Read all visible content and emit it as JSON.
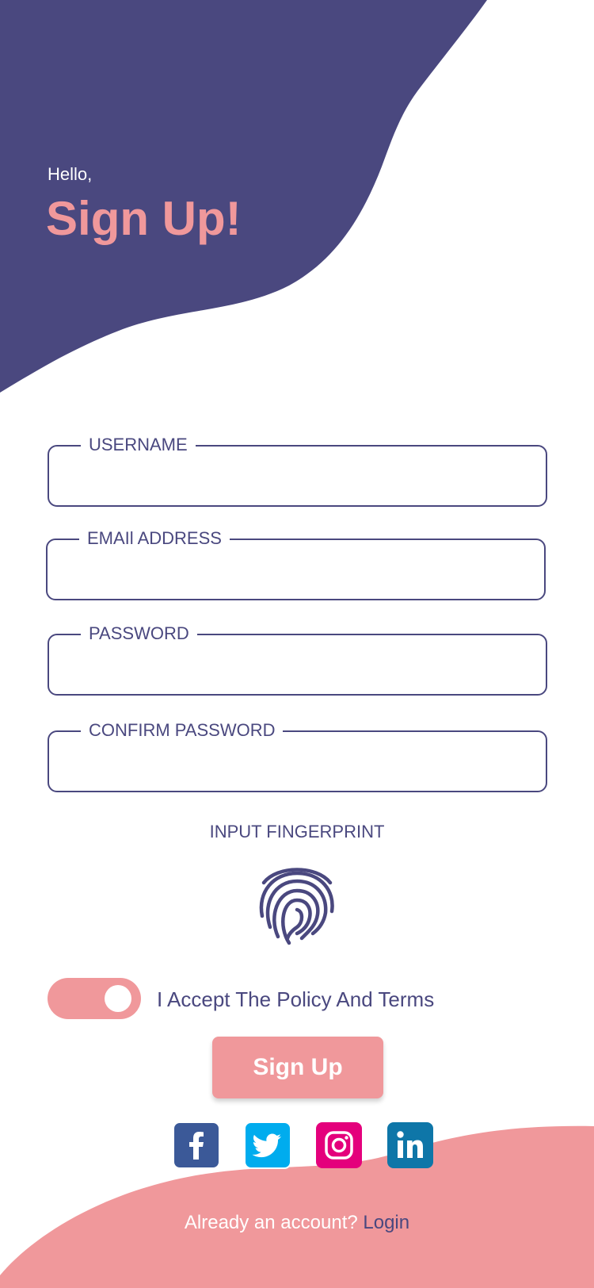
{
  "header": {
    "greeting": "Hello,",
    "title": "Sign Up!"
  },
  "form": {
    "fields": [
      {
        "label": "USERNAME",
        "value": ""
      },
      {
        "label": "EMAIl ADDRESS",
        "value": ""
      },
      {
        "label": "PASSWORD",
        "value": ""
      },
      {
        "label": "CONFIRM PASSWORD",
        "value": ""
      }
    ],
    "fingerprint_label": "INPUT FINGERPRINT",
    "accept_label": "I Accept The Policy And Terms",
    "accept_checked": true,
    "signup_label": "Sign Up"
  },
  "social": [
    {
      "icon": "facebook-icon",
      "color": "#3b5998"
    },
    {
      "icon": "twitter-icon",
      "color": "#00acee"
    },
    {
      "icon": "instagram-icon",
      "color": "#e4007c"
    },
    {
      "icon": "linkedin-icon",
      "color": "#0e76a8"
    }
  ],
  "footer": {
    "text": "Already an account?",
    "link": "Login"
  },
  "colors": {
    "primary": "#4a487f",
    "accent": "#f0989b"
  }
}
